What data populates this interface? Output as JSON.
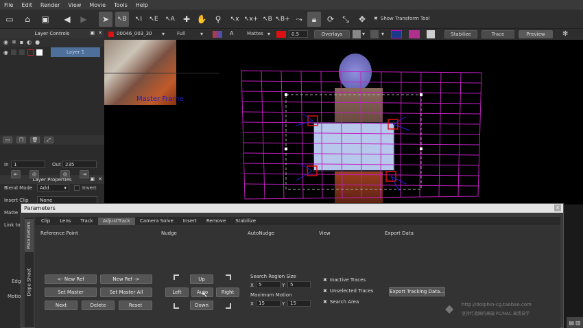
{
  "menu": [
    "File",
    "Edit",
    "Render",
    "View",
    "Movie",
    "Tools",
    "Help"
  ],
  "toolbar": {
    "transform_label": "Show Transform Tool"
  },
  "layer_controls": {
    "title": "Layer Controls",
    "layer_name": "Layer 1"
  },
  "layer_props": {
    "title": "Layer Properties",
    "in_label": "In",
    "in_value": "1",
    "out_label": "Out",
    "out_value": "235",
    "blend_label": "Blend Mode",
    "blend_value": "Add",
    "invert_label": "Invert",
    "insert_label": "Insert Clip",
    "insert_value": "None",
    "matte_label": "Matte",
    "link_label": "Link to",
    "edge_label": "Edg",
    "motion_label": "Motio"
  },
  "viewbar": {
    "clip": "00046_003_30",
    "res": "Full",
    "mattes": "Mattes",
    "opacity": "0.5",
    "overlays": "Overlays",
    "stabilize": "Stabilize",
    "trace": "Trace",
    "preview": "Preview"
  },
  "viewer": {
    "overlay_text": "Master Frame"
  },
  "parameters": {
    "title": "Parameters",
    "side_tabs": [
      "Parameters",
      "Dope Sheet"
    ],
    "tabs": [
      "Clip",
      "Lens",
      "Track",
      "AdjustTrack",
      "Camera Solve",
      "Insert",
      "Remove",
      "Stabilize"
    ],
    "active_tab": "AdjustTrack",
    "sections": [
      "Reference Point",
      "Nudge",
      "AutoNudge",
      "View",
      "Export Data"
    ],
    "buttons": {
      "new_ref_prev": "<- New Ref",
      "new_ref_next": "New Ref ->",
      "set_master": "Set Master",
      "set_master_all": "Set Master All",
      "next": "Next",
      "delete": "Delete",
      "reset": "Reset",
      "up": "Up",
      "left": "Left",
      "auto": "Auto",
      "right": "Right",
      "down": "Down",
      "export": "Export Tracking Data..."
    },
    "search_region": {
      "label": "Search Region Size",
      "x": "5",
      "y": "5"
    },
    "max_motion": {
      "label": "Maximum Motion",
      "x": "15",
      "y": "15"
    },
    "axis_x": "X",
    "axis_y": "Y",
    "checks": [
      "Inactive Traces",
      "Unselected Traces",
      "Search Area"
    ]
  },
  "watermark": {
    "url": "http://dolphin-cg.taobao.com",
    "sub": "坚持打造国内高端 PC/MAC 高清自学"
  }
}
